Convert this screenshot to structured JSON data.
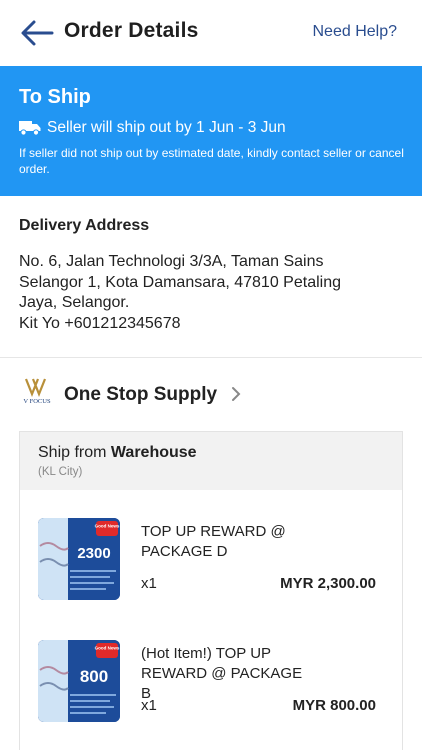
{
  "header": {
    "title": "Order Details",
    "help_label": "Need Help?"
  },
  "status": {
    "title": "To Ship",
    "ship_text": "Seller will ship out by 1 Jun - 3 Jun",
    "note": "If seller did not ship out by estimated date, kindly contact seller or cancel order.",
    "banner_color": "#2196f3"
  },
  "address": {
    "heading": "Delivery Address",
    "lines": [
      "No. 6, Jalan Technologi 3/3A, Taman Sains",
      "Selangor 1, Kota Damansara, 47810 Petaling",
      "Jaya, Selangor.",
      "Kit Yo +601212345678"
    ]
  },
  "shop": {
    "name": "One Stop Supply",
    "logo_text": "V FOCUS"
  },
  "shipping": {
    "prefix": "Ship from",
    "source": "Warehouse",
    "city": "(KL City)"
  },
  "products": [
    {
      "name": "TOP UP REWARD @ PACKAGE D",
      "qty": "x1",
      "price": "MYR 2,300.00",
      "promo_amount": "2300",
      "badge": "Good News"
    },
    {
      "name": "(Hot Item!) TOP UP REWARD @ PACKAGE B",
      "qty": "x1",
      "price": "MYR 800.00",
      "promo_amount": "800",
      "badge": "Good News"
    }
  ]
}
